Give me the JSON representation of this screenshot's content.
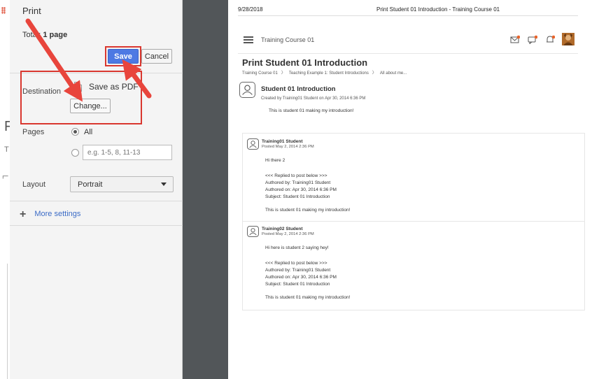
{
  "dialog": {
    "title": "Print",
    "total_prefix": "Total: ",
    "total_bold": "1 page",
    "save_label": "Save",
    "cancel_label": "Cancel",
    "destination_label": "Destination",
    "destination_value": "Save as PDF",
    "change_label": "Change...",
    "pages_label": "Pages",
    "pages_all_label": "All",
    "pages_custom_placeholder": "e.g. 1-5, 8, 11-13",
    "layout_label": "Layout",
    "layout_value": "Portrait",
    "more_settings_label": "More settings"
  },
  "preview": {
    "date": "9/28/2018",
    "header_title": "Print Student 01 Introduction - Training Course 01",
    "course_name": "Training Course 01",
    "page_title": "Print Student 01 Introduction",
    "breadcrumbs": [
      "Training Course 01",
      "Teaching Example 1: Student Introductions",
      "All about me..."
    ],
    "post": {
      "title": "Student 01 Introduction",
      "meta": "Created by Training01 Student on Apr 30, 2014 6:36 PM",
      "body": "This is student 01 making my introduction!"
    },
    "replies": [
      {
        "author": "Training01 Student",
        "posted": "Posted May 2, 2014 2:36 PM",
        "text": "Hi there 2",
        "quote_header": "<<< Replied to post below >>>",
        "authored_by": "Authored by: Training01 Student",
        "authored_on": "Authored on: Apr 30, 2014 6:36 PM",
        "subject": "Subject: Student 01 Introduction",
        "quoted": "This is student 01 making my introduction!"
      },
      {
        "author": "Training02 Student",
        "posted": "Posted May 2, 2014 2:36 PM",
        "text": "Hi here is student 2 saying hey!",
        "quote_header": "<<< Replied to post below >>>",
        "authored_by": "Authored by: Training01 Student",
        "authored_on": "Authored on: Apr 30, 2014 6:36 PM",
        "subject": "Subject: Student 01 Introduction",
        "quoted": "This is student 01 making my introduction!"
      }
    ]
  },
  "colors": {
    "save_button": "#4d79e3",
    "highlight": "#d9372f",
    "arrow": "#e8453c",
    "link": "#3c6cc6",
    "preview_background": "#525659"
  },
  "icons": [
    "menu-icon",
    "mail-icon",
    "chat-icon",
    "bell-icon",
    "user-avatar",
    "person-icon",
    "plus-icon",
    "pdf-file-icon",
    "dropdown-caret-icon"
  ]
}
